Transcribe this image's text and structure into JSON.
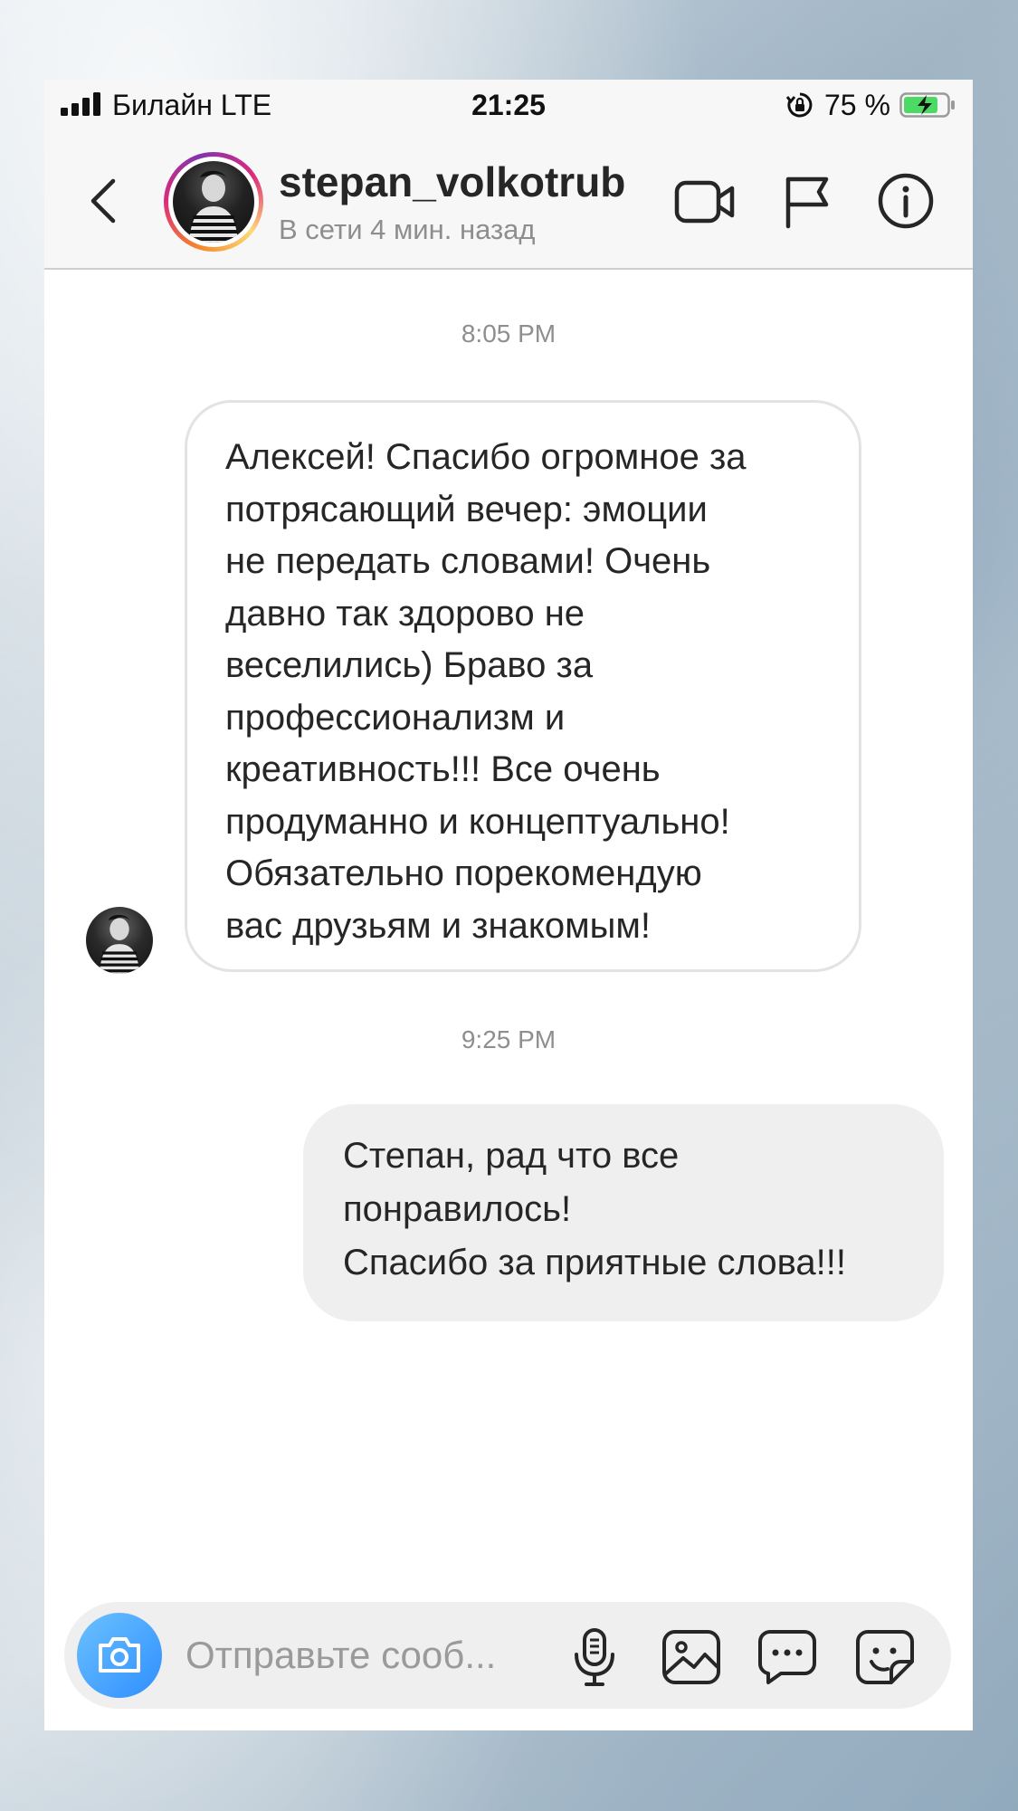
{
  "status_bar": {
    "carrier": "Билайн  LTE",
    "time": "21:25",
    "battery_percent": "75 %"
  },
  "header": {
    "username": "stepan_volkotrub",
    "presence": "В сети 4 мин. назад",
    "icons": [
      "back-icon",
      "video-icon",
      "flag-icon",
      "info-icon"
    ]
  },
  "conversation": {
    "timestamp_1": "8:05 PM",
    "incoming_message": "Алексей! Спасибо огромное за\nпотрясающий вечер: эмоции\nне передать словами! Очень\nдавно так здорово не\nвеселились) Браво за\nпрофессионализм и\nкреативность!!! Все очень\nпродуманно и концептуально!\nОбязательно порекомендую\nвас друзьям и знакомым!",
    "timestamp_2": "9:25 PM",
    "outgoing_message": "Степан, рад что все\nпонравилось!\nСпасибо за приятные слова!!!"
  },
  "composer": {
    "placeholder": "Отправьте сооб...",
    "icons": [
      "camera-icon",
      "microphone-icon",
      "gallery-icon",
      "chat-icon",
      "sticker-icon"
    ]
  },
  "colors": {
    "battery_fill": "#4cd964",
    "camera_button": "#2e8fff",
    "outgoing_bubble": "#efefef",
    "secondary_text": "#8e8e8e"
  }
}
